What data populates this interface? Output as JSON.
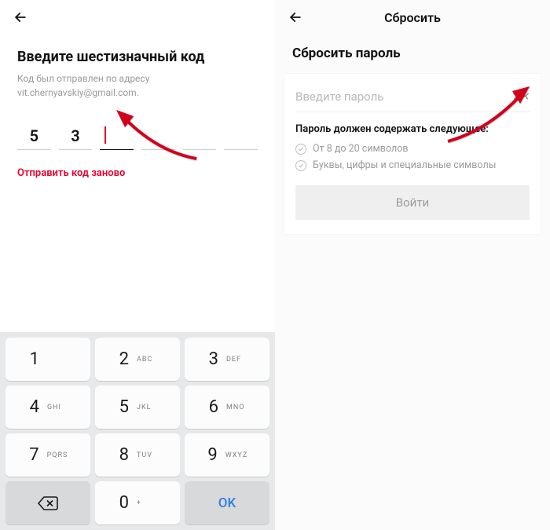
{
  "left": {
    "title": "Введите шестизначный код",
    "subtitle_prefix": "Код был отправлен по адресу ",
    "subtitle_email": "vit.chernyavskiy@gmail.com",
    "subtitle_suffix": ".",
    "code": [
      "5",
      "3",
      "",
      "",
      "",
      ""
    ],
    "active_index": 2,
    "resend": "Отправить код заново"
  },
  "right": {
    "topbar_title": "Сбросить",
    "heading": "Сбросить пароль",
    "password_placeholder": "Введите пароль",
    "rules_title": "Пароль должен содержать следующее:",
    "rules": [
      "От 8 до 20 символов",
      "Буквы, цифры и специальные символы"
    ],
    "login": "Войти"
  },
  "keypad": {
    "keys": [
      [
        {
          "d": "1",
          "l": ""
        },
        {
          "d": "2",
          "l": "ABC"
        },
        {
          "d": "3",
          "l": "DEF"
        }
      ],
      [
        {
          "d": "4",
          "l": "GHI"
        },
        {
          "d": "5",
          "l": "JKL"
        },
        {
          "d": "6",
          "l": "MNO"
        }
      ],
      [
        {
          "d": "7",
          "l": "PQRS"
        },
        {
          "d": "8",
          "l": "TUV"
        },
        {
          "d": "9",
          "l": "WXYZ"
        }
      ]
    ],
    "zero": {
      "d": "0",
      "l": "+"
    },
    "ok": "OK"
  }
}
